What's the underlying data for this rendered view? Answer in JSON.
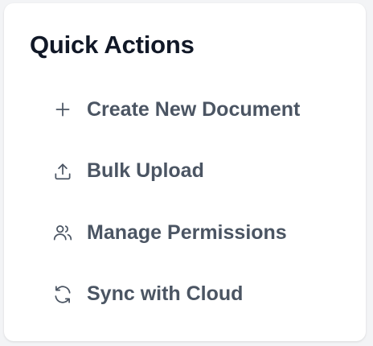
{
  "panel": {
    "title": "Quick Actions",
    "actions": [
      {
        "label": "Create New Document",
        "icon": "plus-icon"
      },
      {
        "label": "Bulk Upload",
        "icon": "upload-icon"
      },
      {
        "label": "Manage Permissions",
        "icon": "users-icon"
      },
      {
        "label": "Sync with Cloud",
        "icon": "refresh-icon"
      }
    ]
  },
  "colors": {
    "title": "#111827",
    "action_text": "#4b5563",
    "card_background": "#ffffff",
    "page_background": "#f3f4f6"
  }
}
